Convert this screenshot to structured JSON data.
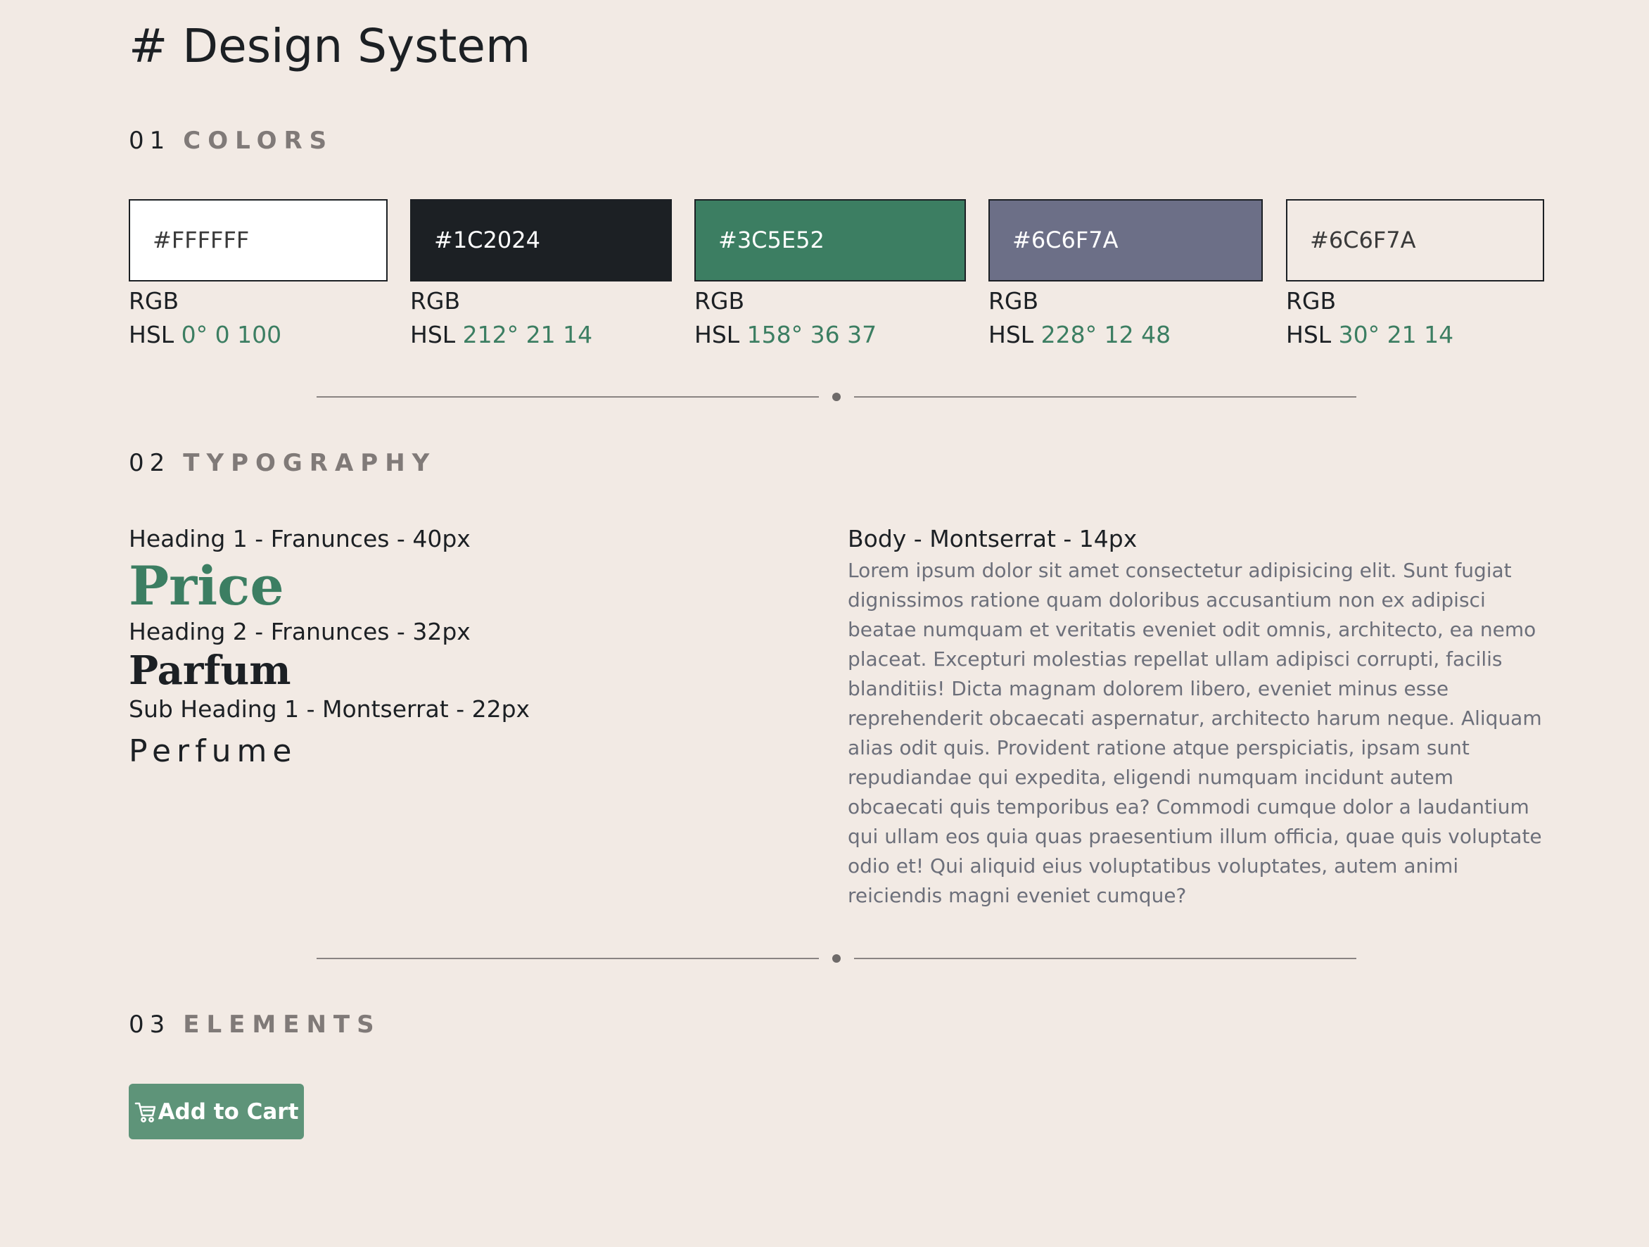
{
  "title": "# Design System",
  "sections": {
    "colors": {
      "number": "01",
      "label": "COLORS"
    },
    "typography": {
      "number": "02",
      "label": "TYPOGRAPHY"
    },
    "elements": {
      "number": "03",
      "label": "ELEMENTS"
    }
  },
  "swatches": [
    {
      "hex": "#FFFFFF",
      "rgb_label": "RGB",
      "hsl_label": "HSL",
      "hsl_values": "0° 0 100",
      "fill": "#FFFFFF",
      "text_color": "#3A3A3A"
    },
    {
      "hex": "#1C2024",
      "rgb_label": "RGB",
      "hsl_label": "HSL",
      "hsl_values": "212° 21 14",
      "fill": "#1C2024",
      "text_color": "#FFFFFF"
    },
    {
      "hex": "#3C5E52",
      "rgb_label": "RGB",
      "hsl_label": "HSL",
      "hsl_values": "158° 36 37",
      "fill": "#3C7E62",
      "text_color": "#FFFFFF"
    },
    {
      "hex": "#6C6F7A",
      "rgb_label": "RGB",
      "hsl_label": "HSL",
      "hsl_values": "228° 12 48",
      "fill": "#6C6F87",
      "text_color": "#FFFFFF"
    },
    {
      "hex": "#6C6F7A",
      "rgb_label": "RGB",
      "hsl_label": "HSL",
      "hsl_values": "30° 21 14",
      "fill": "#F2EAE4",
      "text_color": "#3A3A3A"
    }
  ],
  "typography": {
    "h1_label": "Heading 1 - Franunces - 40px",
    "h1_sample": "Price",
    "h2_label": "Heading 2 - Franunces - 32px",
    "h2_sample": "Parfum",
    "sub_label": "Sub Heading 1 - Montserrat - 22px",
    "sub_sample": "Perfume",
    "body_label": "Body - Montserrat - 14px",
    "body_sample": "Lorem ipsum dolor sit amet consectetur adipisicing elit. Sunt fugiat dignissimos ratione quam doloribus accusantium non ex adipisci beatae numquam et veritatis eveniet odit omnis, architecto, ea nemo placeat. Excepturi molestias repellat ullam adipisci corrupti, facilis blanditiis! Dicta magnam dolorem libero, eveniet minus esse reprehenderit obcaecati aspernatur, architecto harum neque. Aliquam alias odit quis. Provident ratione atque perspiciatis, ipsam sunt repudiandae qui expedita, eligendi numquam incidunt autem obcaecati quis temporibus ea? Commodi cumque dolor a laudantium qui ullam eos quia quas praesentium illum officia, quae quis voluptate odio et! Qui aliquid eius voluptatibus voluptates, autem animi reiciendis magni eveniet cumque?"
  },
  "elements": {
    "add_to_cart_label": "Add to Cart",
    "add_to_cart_icon": "cart-icon"
  },
  "colors": {
    "background": "#F2EAE4",
    "accent_green": "#3C7E62",
    "button_green": "#5E9479",
    "muted_heading": "#807A78"
  }
}
